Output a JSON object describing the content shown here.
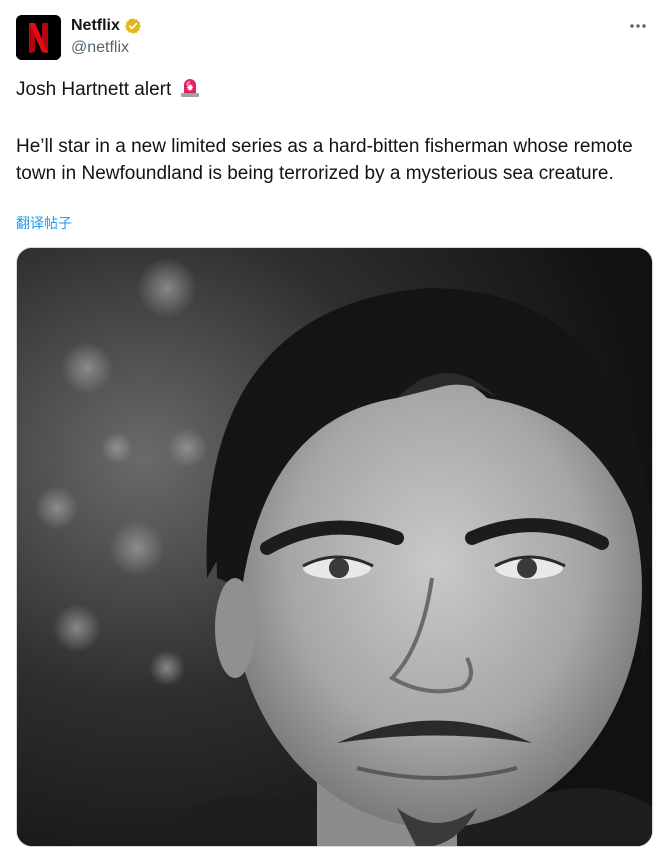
{
  "author": {
    "display_name": "Netflix",
    "handle": "@netflix",
    "avatar_letter": "N",
    "verified": true,
    "verified_color": "#e2b719",
    "brand_color": "#e50914"
  },
  "tweet": {
    "line1": "Josh Hartnett alert",
    "line2": "He’ll star in a new limited series as a hard-bitten fisherman whose remote town in Newfoundland is being terrorized by a mysterious sea creature.",
    "emoji_icon": "rotating-siren-icon"
  },
  "translate": {
    "label": "翻译帖子"
  },
  "menu": {
    "icon": "more-horizontal-icon"
  },
  "media": {
    "subject": "black-and-white portrait photo"
  }
}
